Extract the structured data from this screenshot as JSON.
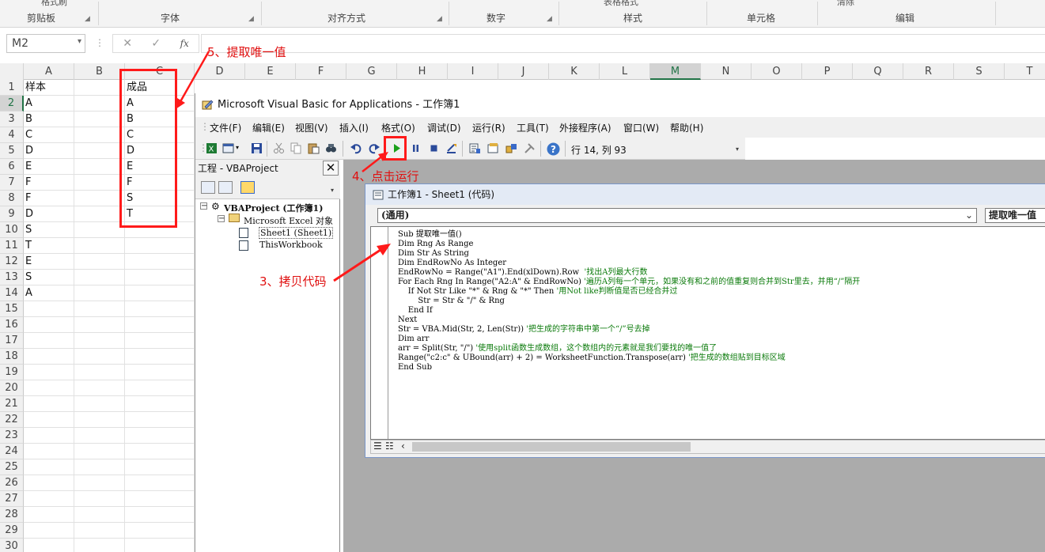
{
  "ribbon": {
    "groups": [
      "剪贴板",
      "字体",
      "对齐方式",
      "数字",
      "样式",
      "单元格",
      "编辑"
    ],
    "partial_top": [
      "格式刷",
      "表格格式",
      "清除"
    ]
  },
  "formula_bar": {
    "name_box": "M2",
    "cancel_glyph": "✕",
    "enter_glyph": "✓",
    "fx_glyph": "fx",
    "value": ""
  },
  "sheet": {
    "columns": [
      "A",
      "B",
      "C",
      "D",
      "E",
      "F",
      "G",
      "H",
      "I",
      "J",
      "K",
      "L",
      "M",
      "N",
      "O",
      "P",
      "Q",
      "R",
      "S",
      "T"
    ],
    "selected_column": "M",
    "selected_row": "2",
    "rows": [
      "1",
      "2",
      "3",
      "4",
      "5",
      "6",
      "7",
      "8",
      "9",
      "10",
      "11",
      "12",
      "13",
      "14",
      "15",
      "16",
      "17",
      "18",
      "19",
      "20",
      "21",
      "22",
      "23",
      "24",
      "25",
      "26",
      "27",
      "28",
      "29",
      "30"
    ],
    "col_a": [
      "样本",
      "A",
      "B",
      "C",
      "D",
      "E",
      "F",
      "F",
      "D",
      "S",
      "T",
      "E",
      "S",
      "A"
    ],
    "col_c": [
      "成品",
      "A",
      "B",
      "C",
      "D",
      "E",
      "F",
      "S",
      "T"
    ]
  },
  "annotations": {
    "step5": "5、提取唯一值",
    "step4": "4、点击运行",
    "step3": "3、拷贝代码"
  },
  "vbe": {
    "title": "Microsoft Visual Basic for Applications - 工作簿1",
    "menus": [
      "文件(F)",
      "编辑(E)",
      "视图(V)",
      "插入(I)",
      "格式(O)",
      "调试(D)",
      "运行(R)",
      "工具(T)",
      "外接程序(A)",
      "窗口(W)",
      "帮助(H)"
    ],
    "position": "行 14, 列 93",
    "help_glyph": "?",
    "project": {
      "title": "工程 - VBAProject",
      "close_glyph": "✕",
      "root": "VBAProject (工作簿1)",
      "folder": "Microsoft Excel 对象",
      "items": [
        "Sheet1 (Sheet1)",
        "ThisWorkbook"
      ]
    },
    "code_window": {
      "title": "工作簿1 - Sheet1 (代码)",
      "object_combo": "(通用)",
      "proc_combo": "提取唯一值",
      "lines": [
        {
          "code": "Sub 提取唯一值()",
          "comment": ""
        },
        {
          "code": "Dim Rng As Range",
          "comment": ""
        },
        {
          "code": "Dim Str As String",
          "comment": ""
        },
        {
          "code": "Dim EndRowNo As Integer",
          "comment": ""
        },
        {
          "code": "EndRowNo = Range(\"A1\").End(xlDown).Row  ",
          "comment": "'找出A列最大行数"
        },
        {
          "code": "For Each Rng In Range(\"A2:A\" & EndRowNo) ",
          "comment": "'遍历A列每一个单元，如果没有和之前的值重复则合并到Str里去，并用“/”隔开"
        },
        {
          "code": "    If Not Str Like \"*\" & Rng & \"*\" Then ",
          "comment": "'用Not like判断值是否已经合并过"
        },
        {
          "code": "        Str = Str & \"/\" & Rng",
          "comment": ""
        },
        {
          "code": "    End If",
          "comment": ""
        },
        {
          "code": "Next",
          "comment": ""
        },
        {
          "code": "Str = VBA.Mid(Str, 2, Len(Str)) ",
          "comment": "'把生成的字符串中第一个“/”号去掉"
        },
        {
          "code": "Dim arr",
          "comment": ""
        },
        {
          "code": "arr = Split(Str, \"/\") ",
          "comment": "'使用split函数生成数组，这个数组内的元素就是我们要找的唯一值了"
        },
        {
          "code": "Range(\"c2:c\" & UBound(arr) + 2) = WorksheetFunction.Transpose(arr) ",
          "comment": "'把生成的数组贴到目标区域"
        },
        {
          "code": "End Sub",
          "comment": ""
        }
      ]
    }
  },
  "colors": {
    "accent": "#217346",
    "annotation": "#ff1a1a",
    "comment": "#0a7a0a",
    "run": "#1aa01a"
  }
}
